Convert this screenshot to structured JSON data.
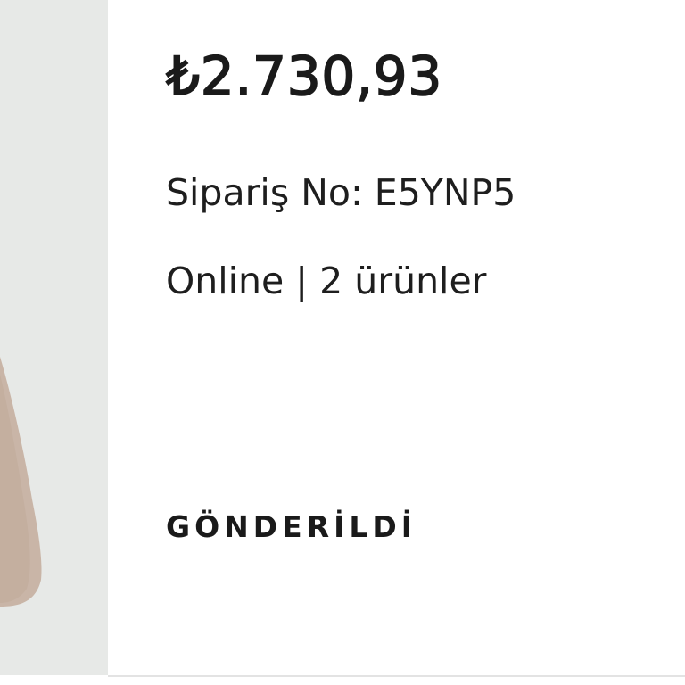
{
  "order": {
    "price": "₺2.730,93",
    "order_number": "Sipariş No: E5YNP5",
    "channel_and_count": "Online | 2 ürünler",
    "status": "GÖNDERİLDİ"
  }
}
